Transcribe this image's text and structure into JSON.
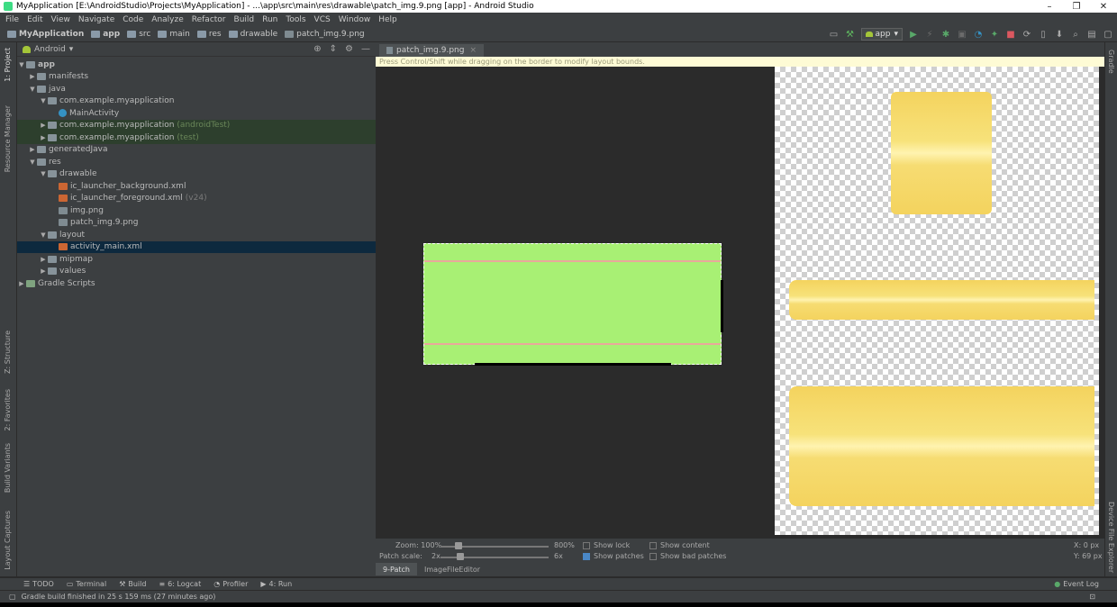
{
  "window": {
    "title": "MyApplication [E:\\AndroidStudio\\Projects\\MyApplication] - ...\\app\\src\\main\\res\\drawable\\patch_img.9.png [app] - Android Studio",
    "minimize": "–",
    "maximize": "❐",
    "close": "✕"
  },
  "menu": [
    "File",
    "Edit",
    "View",
    "Navigate",
    "Code",
    "Analyze",
    "Refactor",
    "Build",
    "Run",
    "Tools",
    "VCS",
    "Window",
    "Help"
  ],
  "breadcrumb": [
    "MyApplication",
    "app",
    "src",
    "main",
    "res",
    "drawable",
    "patch_img.9.png"
  ],
  "toolbar": {
    "config_label": "app"
  },
  "left_tabs": [
    "1: Project",
    "Resource Manager",
    "Z: Structure",
    "2: Favorites",
    "Build Variants",
    "Layout Captures"
  ],
  "right_tabs": [
    "Gradle",
    "Device File Explorer"
  ],
  "project": {
    "view_label": "Android",
    "tree": [
      {
        "label": "app",
        "extra": ""
      },
      {
        "label": "manifests",
        "extra": ""
      },
      {
        "label": "java",
        "extra": ""
      },
      {
        "label": "com.example.myapplication",
        "extra": ""
      },
      {
        "label": "MainActivity",
        "extra": ""
      },
      {
        "label": "com.example.myapplication",
        "extra": "(androidTest)"
      },
      {
        "label": "com.example.myapplication",
        "extra": "(test)"
      },
      {
        "label": "generatedJava",
        "extra": ""
      },
      {
        "label": "res",
        "extra": ""
      },
      {
        "label": "drawable",
        "extra": ""
      },
      {
        "label": "ic_launcher_background.xml",
        "extra": ""
      },
      {
        "label": "ic_launcher_foreground.xml",
        "extra": "(v24)"
      },
      {
        "label": "img.png",
        "extra": ""
      },
      {
        "label": "patch_img.9.png",
        "extra": ""
      },
      {
        "label": "layout",
        "extra": ""
      },
      {
        "label": "activity_main.xml",
        "extra": ""
      },
      {
        "label": "mipmap",
        "extra": ""
      },
      {
        "label": "values",
        "extra": ""
      },
      {
        "label": "Gradle Scripts",
        "extra": ""
      }
    ]
  },
  "editor": {
    "tab_label": "patch_img.9.png",
    "hint": "Press Control/Shift while dragging on the border to modify layout bounds.",
    "zoom_label": "Zoom: 100%",
    "zoom_max": "800%",
    "zoom_level": 0.0,
    "scale_label": "Patch scale:",
    "scale_min": "2x",
    "scale_max": "6x",
    "scale_level": 0.1,
    "show_lock": "Show lock",
    "show_patches": "Show patches",
    "show_content": "Show content",
    "show_bad_patches": "Show bad patches",
    "coord_x": "X:  0 px",
    "coord_y": "Y: 69 px",
    "subtab_1": "9-Patch",
    "subtab_2": "ImageFileEditor"
  },
  "bottom": {
    "todo": "TODO",
    "terminal": "Terminal",
    "build": "Build",
    "logcat": "6: Logcat",
    "profiler": "Profiler",
    "run": "4: Run",
    "event_log": "Event Log"
  },
  "status": "Gradle build finished in 25 s 159 ms (27 minutes ago)",
  "colors": {
    "patch_green": "#a8f074",
    "patch_yellow": "#f4d35e",
    "guide_pink": "#f0a0a0"
  }
}
